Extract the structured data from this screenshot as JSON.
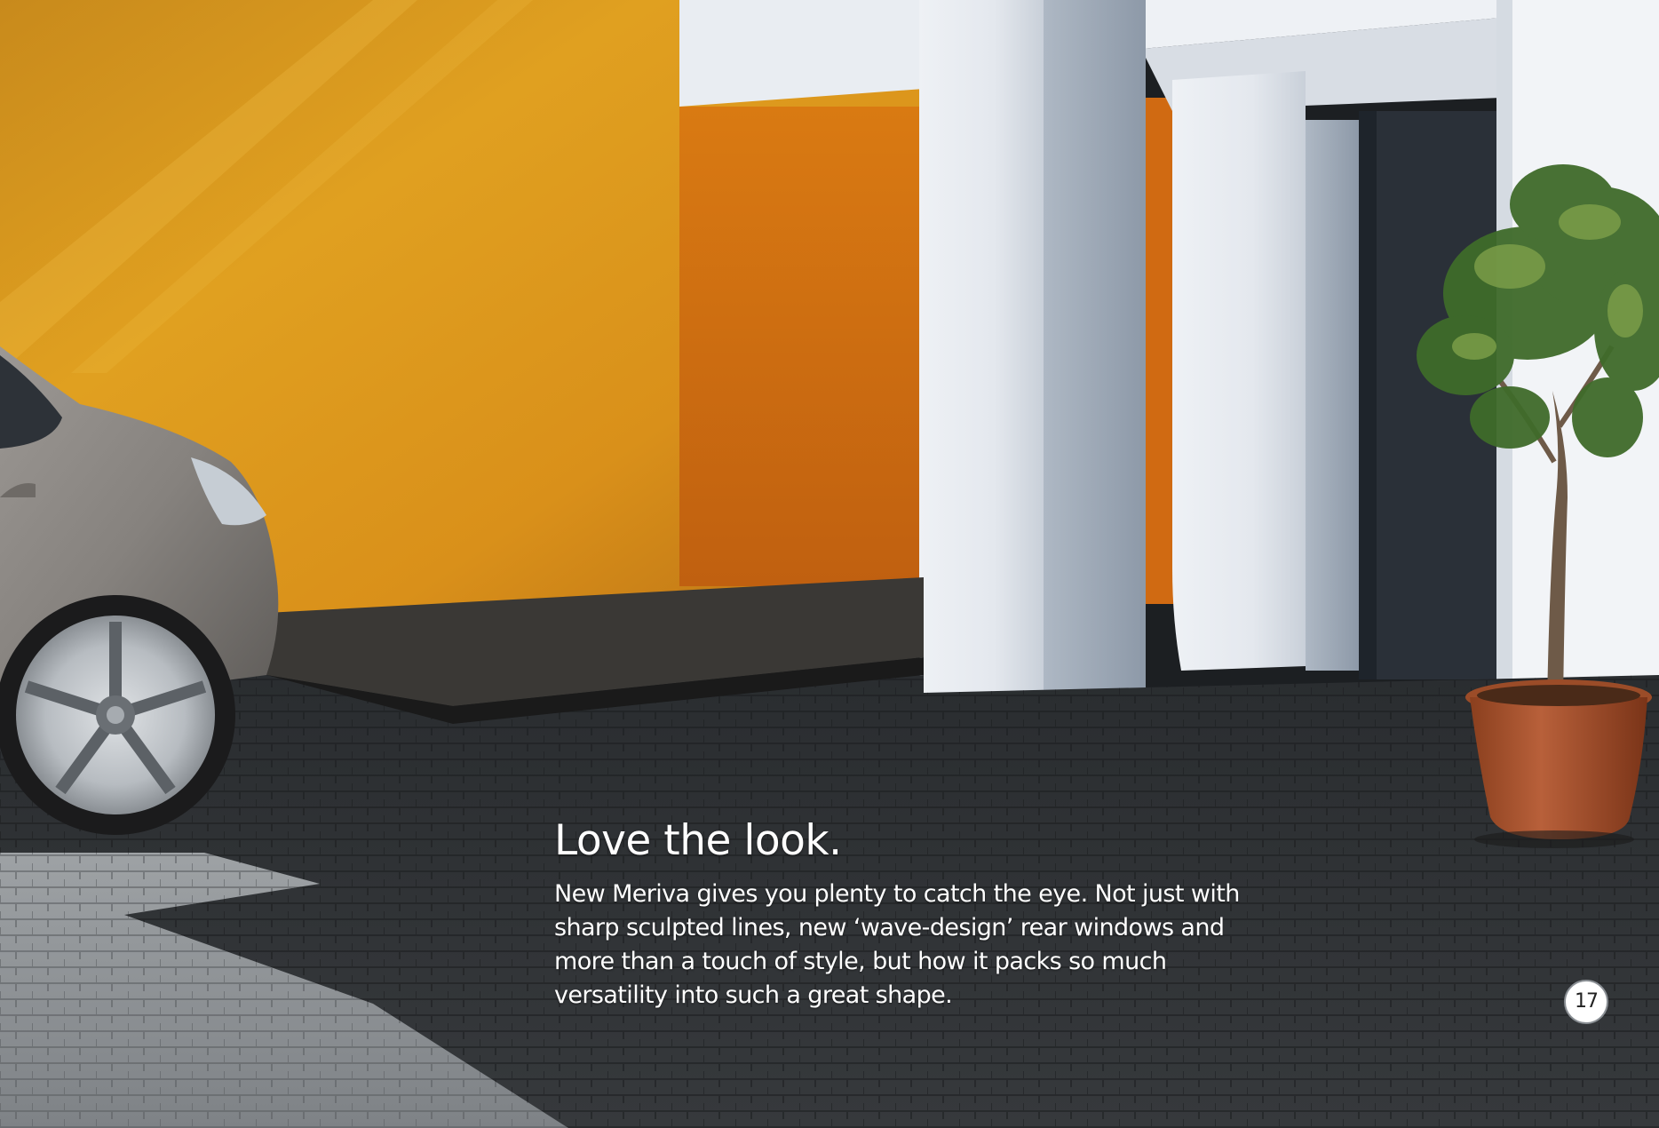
{
  "article": {
    "headline": "Love the look.",
    "body": "New Meriva gives you plenty to catch the eye. Not just with sharp sculpted lines, new ‘wave-design’ rear windows and more than a touch of style, but how it packs so much versatility into such a great shape."
  },
  "page_number": "17",
  "colors": {
    "wall": "#e09a1e",
    "pillar": "#f2f4f7",
    "paving": "#2e3134",
    "text": "#ffffff"
  }
}
